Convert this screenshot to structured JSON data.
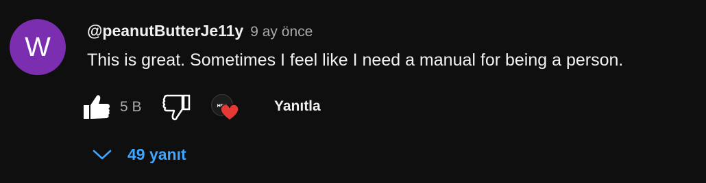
{
  "comment": {
    "avatar_letter": "W",
    "avatar_color": "#7b2fb0",
    "author": "@peanutButterJe11y",
    "time": "9 ay önce",
    "text": "This is great. Sometimes I feel like I need a manual for being a person."
  },
  "actions": {
    "like_icon": "thumbs-up-icon",
    "like_count": "5 B",
    "dislike_icon": "thumbs-down-icon",
    "creator_heart_icon": "creator-heart-icon",
    "creator_heart_avatar_text": "HBF",
    "heart_color": "#e53935",
    "reply_label": "Yanıtla"
  },
  "replies": {
    "chevron_icon": "chevron-down-icon",
    "label": "49 yanıt",
    "color": "#3ea6ff"
  }
}
